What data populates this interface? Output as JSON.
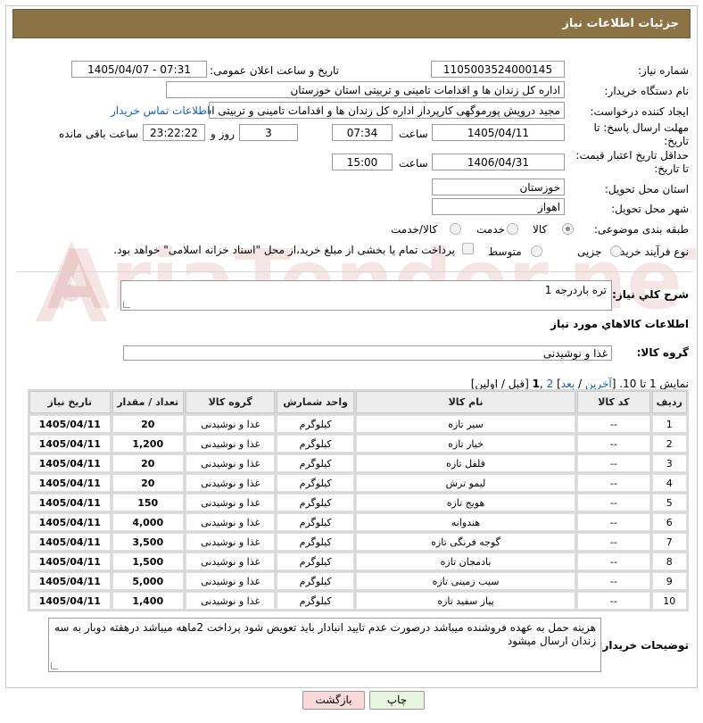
{
  "page": {
    "header_title": "جزئیات اطلاعات نیاز"
  },
  "labels": {
    "need_number": "شماره نیاز:",
    "announce_datetime": "تاریخ و ساعت اعلان عمومی:",
    "buyer_org": "نام دستگاه خریدار:",
    "requester": "ایجاد کننده درخواست:",
    "reply_deadline": "مهلت ارسال پاسخ: تا تاریخ:",
    "price_validity": "حداقل تاریخ اعتبار قیمت: تا تاریخ:",
    "time": "ساعت",
    "days_and": "روز و",
    "remaining": "ساعت باقی مانده",
    "delivery_province": "استان محل تحویل:",
    "delivery_city": "شهر محل تحویل:",
    "category": "طبقه بندی موضوعی:",
    "process_type": "نوع فرآیند خرید :",
    "general_desc": "شرح کلي نياز:",
    "goods_info": "اطلاعات کالاهاي مورد نياز",
    "goods_group": "گروه کالا:",
    "buyer_notes": "توضیحات خریدار:"
  },
  "fields": {
    "need_number": "1105003524000145",
    "announce_datetime": "1405/04/07 - 07:31",
    "buyer_org": "اداره کل زندان ها و اقدامات تامینی و تربیتی استان خوزستان",
    "requester": "مجید درویش پورموگهی کارپرداز اداره کل زندان ها و اقدامات تامینی و تربیتی است",
    "contact_link": "اطلاعات تماس خریدار",
    "reply_date": "1405/04/11",
    "reply_time": "07:34",
    "reply_days": "3",
    "reply_remaining": "23:22:22",
    "validity_date": "1406/04/31",
    "validity_time": "15:00",
    "province": "خوزستان",
    "city": "اهواز",
    "general_desc": "تره باردرجه 1",
    "goods_group": "غذا و نوشیدنی",
    "buyer_notes": "هزینه حمل به عهده فروشنده میباشد درصورت عدم تایید انبادار باید تعویض شود پرداخت 2ماهه میباشد درهفته دوبار به سه زندان ارسال میشود"
  },
  "category_options": [
    {
      "label": "کالا",
      "checked": true
    },
    {
      "label": "خدمت",
      "checked": false
    },
    {
      "label": "کالا/خدمت",
      "checked": false
    }
  ],
  "process_options": [
    {
      "label": "جزیی",
      "checked": false
    },
    {
      "label": "متوسط",
      "checked": false
    }
  ],
  "payment_note": "پرداخت تمام یا بخشی از مبلغ خرید،از محل \"اسناد خزانه اسلامی\" خواهد بود.",
  "pagination": {
    "prefix": "نمایش 1 تا 10. [",
    "last": "آخرین",
    "sep1": " / ",
    "next": "بعد",
    "sep2": "] ",
    "page2": "2",
    "sep3": " ,",
    "page1": "1",
    "suffix": " [قبل / اولین]"
  },
  "table": {
    "headers": [
      "ردیف",
      "کد کالا",
      "نام کالا",
      "واحد شمارش",
      "گروه کالا",
      "تعداد / مقدار",
      "تاریخ نیاز"
    ],
    "rows": [
      [
        "1",
        "--",
        "سیر تازه",
        "کیلوگرم",
        "غذا و نوشیدنی",
        "20",
        "1405/04/11"
      ],
      [
        "2",
        "--",
        "خیار تازه",
        "کیلوگرم",
        "غذا و نوشیدنی",
        "1,200",
        "1405/04/11"
      ],
      [
        "3",
        "--",
        "فلفل تازه",
        "کیلوگرم",
        "غذا و نوشیدنی",
        "20",
        "1405/04/11"
      ],
      [
        "4",
        "--",
        "لیمو ترش",
        "کیلوگرم",
        "غذا و نوشیدنی",
        "20",
        "1405/04/11"
      ],
      [
        "5",
        "--",
        "هویج تازه",
        "کیلوگرم",
        "غذا و نوشیدنی",
        "150",
        "1405/04/11"
      ],
      [
        "6",
        "--",
        "هندوانه",
        "کیلوگرم",
        "غذا و نوشیدنی",
        "4,000",
        "1405/04/11"
      ],
      [
        "7",
        "--",
        "گوجه فرنگی تازه",
        "کیلوگرم",
        "غذا و نوشیدنی",
        "3,500",
        "1405/04/11"
      ],
      [
        "8",
        "--",
        "بادمجان تازه",
        "کیلوگرم",
        "غذا و نوشیدنی",
        "1,500",
        "1405/04/11"
      ],
      [
        "9",
        "--",
        "سیب زمینی تازه",
        "کیلوگرم",
        "غذا و نوشیدنی",
        "5,000",
        "1405/04/11"
      ],
      [
        "10",
        "--",
        "پیاز سفید تازه",
        "کیلوگرم",
        "غذا و نوشیدنی",
        "1,400",
        "1405/04/11"
      ]
    ]
  },
  "buttons": {
    "print": "چاپ",
    "back": "بازگشت"
  },
  "watermark": {
    "text": "AriaTender.neT"
  },
  "colors": {
    "header_bg": "#8b7345",
    "link": "#1a5fb4",
    "print_btn": "#e8f6df",
    "back_btn": "#f9d9d9"
  }
}
